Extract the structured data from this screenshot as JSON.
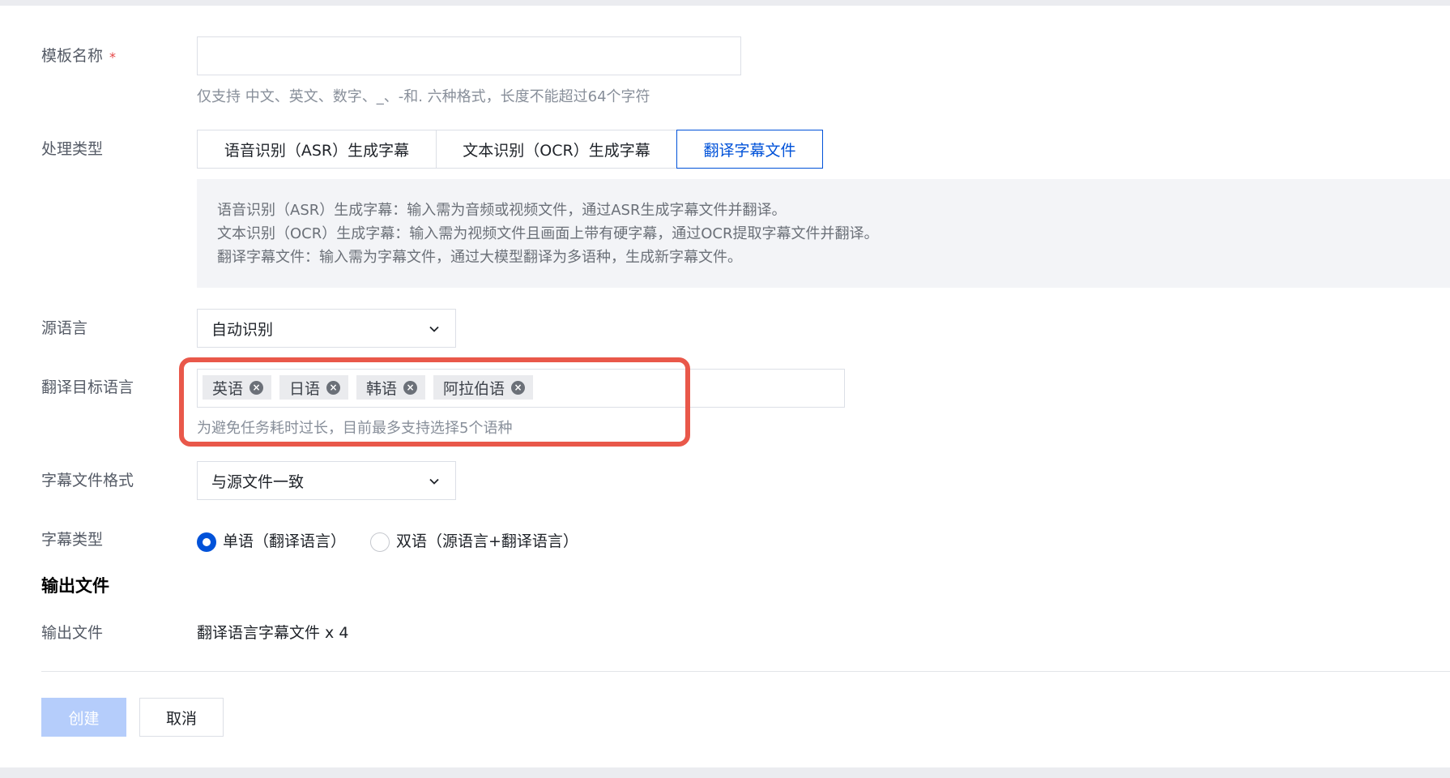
{
  "form": {
    "template_name": {
      "label": "模板名称",
      "required_mark": "*",
      "value": "",
      "hint": "仅支持 中文、英文、数字、_、-和. 六种格式，长度不能超过64个字符"
    },
    "process_type": {
      "label": "处理类型",
      "options": [
        "语音识别（ASR）生成字幕",
        "文本识别（OCR）生成字幕",
        "翻译字幕文件"
      ],
      "selected": "翻译字幕文件",
      "descriptions": [
        "语音识别（ASR）生成字幕：输入需为音频或视频文件，通过ASR生成字幕文件并翻译。",
        "文本识别（OCR）生成字幕：输入需为视频文件且画面上带有硬字幕，通过OCR提取字幕文件并翻译。",
        "翻译字幕文件：输入需为字幕文件，通过大模型翻译为多语种，生成新字幕文件。"
      ]
    },
    "source_language": {
      "label": "源语言",
      "value": "自动识别"
    },
    "target_language": {
      "label": "翻译目标语言",
      "tags": [
        "英语",
        "日语",
        "韩语",
        "阿拉伯语"
      ],
      "hint": "为避免任务耗时过长，目前最多支持选择5个语种"
    },
    "subtitle_format": {
      "label": "字幕文件格式",
      "value": "与源文件一致"
    },
    "subtitle_type": {
      "label": "字幕类型",
      "options": [
        "单语（翻译语言）",
        "双语（源语言+翻译语言）"
      ],
      "selected": "单语（翻译语言）"
    }
  },
  "output": {
    "section_title": "输出文件",
    "label": "输出文件",
    "value": "翻译语言字幕文件 x 4"
  },
  "buttons": {
    "create": "创建",
    "cancel": "取消"
  },
  "colors": {
    "primary": "#0052d9",
    "primary_disabled": "#b5cdfb",
    "highlight_box": "#e9584a",
    "required": "#e54545"
  }
}
